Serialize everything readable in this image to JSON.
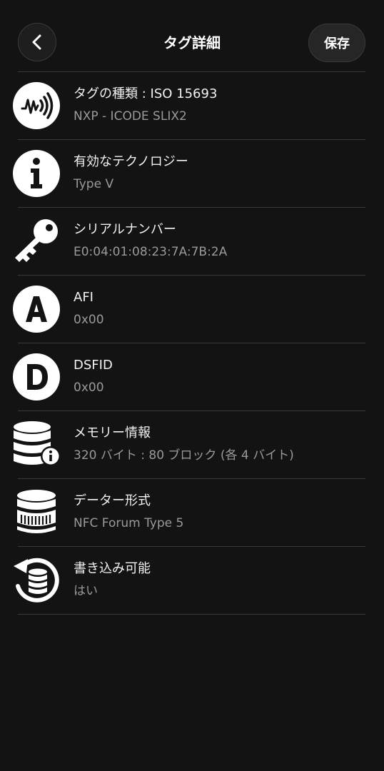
{
  "header": {
    "title": "タグ詳細",
    "save_label": "保存"
  },
  "rows": [
    {
      "icon": "nfc-wave-icon",
      "label": "タグの種類 : ISO 15693",
      "value": "NXP - ICODE SLIX2"
    },
    {
      "icon": "info-icon",
      "label": "有効なテクノロジー",
      "value": "Type V"
    },
    {
      "icon": "key-icon",
      "label": "シリアルナンバー",
      "value": "E0:04:01:08:23:7A:7B:2A"
    },
    {
      "icon": "letter-a-icon",
      "label": "AFI",
      "value": "0x00"
    },
    {
      "icon": "letter-d-icon",
      "label": "DSFID",
      "value": "0x00"
    },
    {
      "icon": "database-info-icon",
      "label": "メモリー情報",
      "value": "320 バイト : 80 ブロック (各 4 バイト)"
    },
    {
      "icon": "database-icon",
      "label": "データー形式",
      "value": "NFC Forum Type 5"
    },
    {
      "icon": "database-refresh-icon",
      "label": "書き込み可能",
      "value": "はい"
    }
  ]
}
